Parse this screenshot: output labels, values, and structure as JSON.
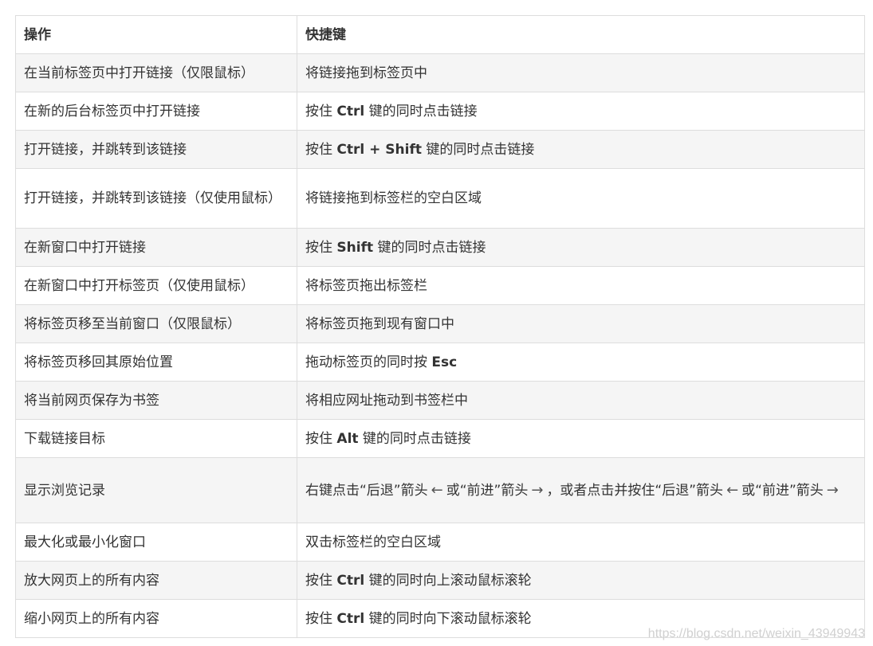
{
  "table": {
    "header": {
      "action": "操作",
      "shortcut": "快捷键"
    },
    "rows": [
      {
        "action": "在当前标签页中打开链接（仅限鼠标）",
        "shortcut": [
          "将链接拖到标签页中"
        ]
      },
      {
        "action": "在新的后台标签页中打开链接",
        "shortcut": [
          "按住 ",
          "Ctrl",
          " 键的同时点击链接"
        ]
      },
      {
        "action": "打开链接，并跳转到该链接",
        "shortcut": [
          "按住 ",
          "Ctrl + Shift",
          " 键的同时点击链接"
        ]
      },
      {
        "action": "打开链接，并跳转到该链接（仅使用鼠标）",
        "shortcut": [
          "将链接拖到标签栏的空白区域"
        ]
      },
      {
        "action": "在新窗口中打开链接",
        "shortcut": [
          "按住 ",
          "Shift",
          " 键的同时点击链接"
        ]
      },
      {
        "action": "在新窗口中打开标签页（仅使用鼠标）",
        "shortcut": [
          "将标签页拖出标签栏"
        ]
      },
      {
        "action": "将标签页移至当前窗口（仅限鼠标）",
        "shortcut": [
          "将标签页拖到现有窗口中"
        ]
      },
      {
        "action": "将标签页移回其原始位置",
        "shortcut": [
          "拖动标签页的同时按 ",
          "Esc"
        ]
      },
      {
        "action": "将当前网页保存为书签",
        "shortcut": [
          "将相应网址拖动到书签栏中"
        ]
      },
      {
        "action": "下载链接目标",
        "shortcut": [
          "按住 ",
          "Alt",
          " 键的同时点击链接"
        ]
      },
      {
        "action": "显示浏览记录",
        "shortcut": [
          "右键点击“后退”箭头",
          "或“前进”箭头",
          "，或者点击并按住“后退”箭头",
          "或“前进”箭头"
        ]
      },
      {
        "action": "最大化或最小化窗口",
        "shortcut": [
          "双击标签栏的空白区域"
        ]
      },
      {
        "action": "放大网页上的所有内容",
        "shortcut": [
          "按住 ",
          "Ctrl",
          " 键的同时向上滚动鼠标滚轮"
        ]
      },
      {
        "action": "缩小网页上的所有内容",
        "shortcut": [
          "按住 ",
          "Ctrl",
          " 键的同时向下滚动鼠标滚轮"
        ]
      }
    ]
  },
  "icons": {
    "back": "arrow-left-icon",
    "forward": "arrow-right-icon"
  },
  "watermark": "https://blog.csdn.net/weixin_43949943"
}
